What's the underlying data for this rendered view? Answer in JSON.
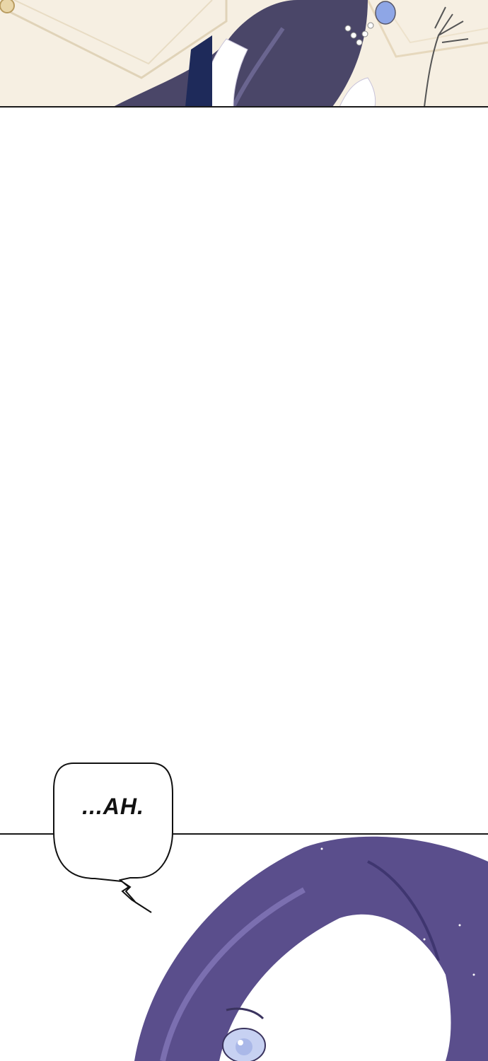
{
  "panels": {
    "top": {
      "description_colors": {
        "background": "#f6efe2",
        "hair": "#4a4668",
        "skin": "#ffffff"
      }
    },
    "bottom": {
      "description_colors": {
        "hair": "#5a4e8c",
        "skin": "#ffffff",
        "eye": "#aab8e8"
      }
    }
  },
  "speech_bubble": {
    "text": "...AH."
  }
}
